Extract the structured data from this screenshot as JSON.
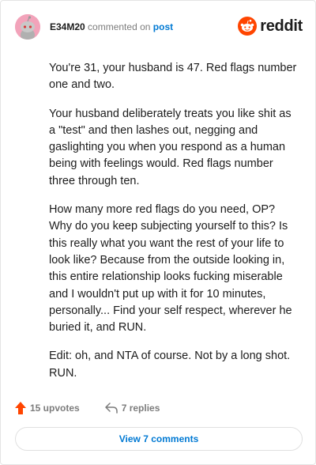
{
  "header": {
    "username": "E34M20",
    "action_text": "commented on",
    "post_link": "post",
    "brand": "reddit",
    "avatar_icon": "snoo-avatar-icon",
    "brand_color": "#ff4500",
    "avatar_color": "#f2a3ba"
  },
  "comment": {
    "paragraphs": [
      "You're 31, your husband is 47. Red flags number one and two.",
      "Your husband deliberately treats you like shit as a \"test\" and then lashes out, negging and gaslighting you when you respond as a human being with feelings would. Red flags number three through ten.",
      "How many more red flags do you need, OP? Why do you keep subjecting yourself to this? Is this really what you want the rest of your life to look like? Because from the outside looking in, this entire relationship looks fucking miserable and I wouldn't put up with it for 10 minutes, personally... Find your self respect, wherever he buried it, and RUN.",
      "Edit: oh, and NTA of course. Not by a long shot. RUN."
    ]
  },
  "footer": {
    "upvotes": "15 upvotes",
    "replies": "7 replies",
    "upvote_icon": "upvote-arrow-icon",
    "reply_icon": "reply-arrow-icon",
    "view_comments": "View 7 comments"
  }
}
